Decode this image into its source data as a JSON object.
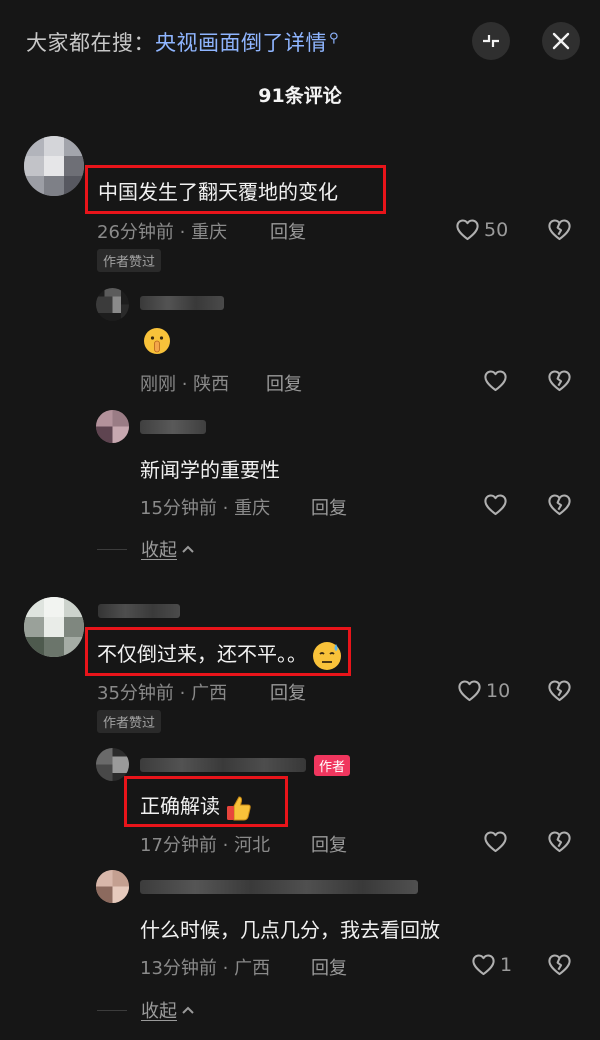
{
  "header": {
    "search_prefix": "大家都在搜：",
    "search_query": "央视画面倒了详情",
    "comment_count": "91条评论",
    "shrink_icon": "shrink-icon",
    "close_icon": "close-icon"
  },
  "reply_label": "回复",
  "collapse_label": "收起",
  "comments": [
    {
      "text": "中国发生了翻天覆地的变化",
      "meta": "26分钟前 · 重庆",
      "likes": "50",
      "badge": "作者赞过",
      "replies": [
        {
          "emoji": "shushing-face-emoji",
          "meta": "刚刚 · 陕西",
          "likes": ""
        },
        {
          "text": "新闻学的重要性",
          "meta": "15分钟前 · 重庆",
          "likes": ""
        }
      ]
    },
    {
      "text": "不仅倒过来，还不平。。",
      "emoji": "sweat-face-emoji",
      "meta": "35分钟前 · 广西",
      "likes": "10",
      "badge": "作者赞过",
      "replies": [
        {
          "author_tag": "作者",
          "text": "正确解读",
          "emoji": "thumbs-up-emoji",
          "meta": "17分钟前 · 河北",
          "likes": ""
        },
        {
          "text": "什么时候，几点几分，我去看回放",
          "meta": "13分钟前 · 广西",
          "likes": "1"
        }
      ]
    }
  ],
  "colors": {
    "background": "#161616",
    "link": "#8fb5ff",
    "highlight_box": "#e8141a",
    "author_tag": "#f0365e"
  }
}
